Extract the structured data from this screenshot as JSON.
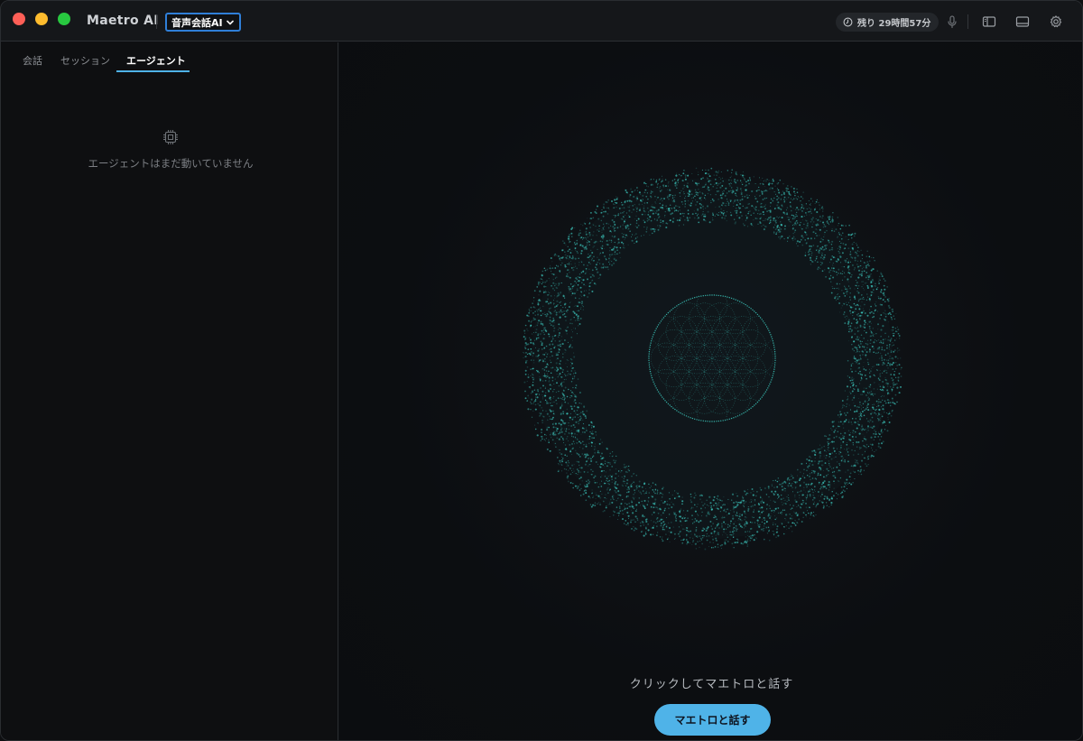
{
  "app": {
    "title": "Maetro AI"
  },
  "mode_select": {
    "label": "音声会話AI"
  },
  "remaining": {
    "text": "残り 29時間57分"
  },
  "sidebar": {
    "tabs": [
      {
        "label": "会話"
      },
      {
        "label": "セッション"
      },
      {
        "label": "エージェント",
        "active": true
      }
    ],
    "empty_state": {
      "text": "エージェントはまだ動いていません"
    }
  },
  "main": {
    "prompt": "クリックしてマエトロと話す",
    "talk_button": "マエトロと話す"
  },
  "colors": {
    "accent": "#4fb3e8",
    "orb": "#3fd3c8",
    "background": "#0d0f12"
  },
  "icons": [
    "timer-icon",
    "microphone-icon",
    "sidebar-toggle-icon",
    "panel-toggle-icon",
    "gear-icon",
    "chip-icon",
    "chevron-down-icon"
  ]
}
